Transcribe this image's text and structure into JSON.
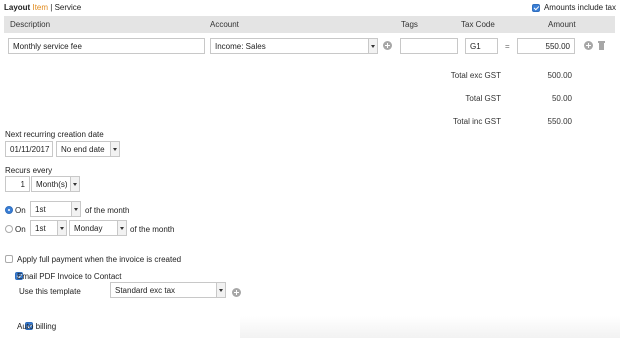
{
  "top": {
    "layout_label": "Layout",
    "item_label": "Item",
    "separator": "|",
    "service_label": "Service",
    "amounts_include_tax": {
      "label": "Amounts include tax",
      "checked": true
    }
  },
  "table": {
    "headers": {
      "description": "Description",
      "account": "Account",
      "tags": "Tags",
      "tax_code": "Tax Code",
      "amount": "Amount"
    },
    "row": {
      "description": "Monthly service fee",
      "account": "Income: Sales",
      "tags": "",
      "tax_code": "G1",
      "equals": "=",
      "amount": "550.00"
    }
  },
  "totals": [
    {
      "label": "Total exc GST",
      "value": "500.00"
    },
    {
      "label": "Total GST",
      "value": "50.00"
    },
    {
      "label": "Total inc GST",
      "value": "550.00"
    }
  ],
  "recurring": {
    "next_creation_label": "Next recurring creation date",
    "next_creation_date": "01/11/2017",
    "end_date_select": "No end date",
    "recurs_every_label": "Recurs every",
    "recurs_every_count": "1",
    "recurs_every_unit": "Month(s)",
    "option_on_day": {
      "label": "On",
      "day": "1st",
      "suffix": "of the month",
      "selected": true
    },
    "option_on_weekday": {
      "label": "On",
      "ordinal": "1st",
      "weekday": "Monday",
      "suffix": "of the month",
      "selected": false
    }
  },
  "options": {
    "apply_full_payment": {
      "label": "Apply full payment when the invoice is created",
      "checked": false
    },
    "email_pdf": {
      "label": "Email PDF Invoice to Contact",
      "checked": true
    },
    "template_label": "Use this template",
    "template_value": "Standard exc tax",
    "auto_billing": {
      "label": "Auto billing",
      "checked": true
    }
  },
  "colors": {
    "accent": "#3b7fd6",
    "active_tab": "#e0891a",
    "header_bg": "#e4e4e4"
  }
}
